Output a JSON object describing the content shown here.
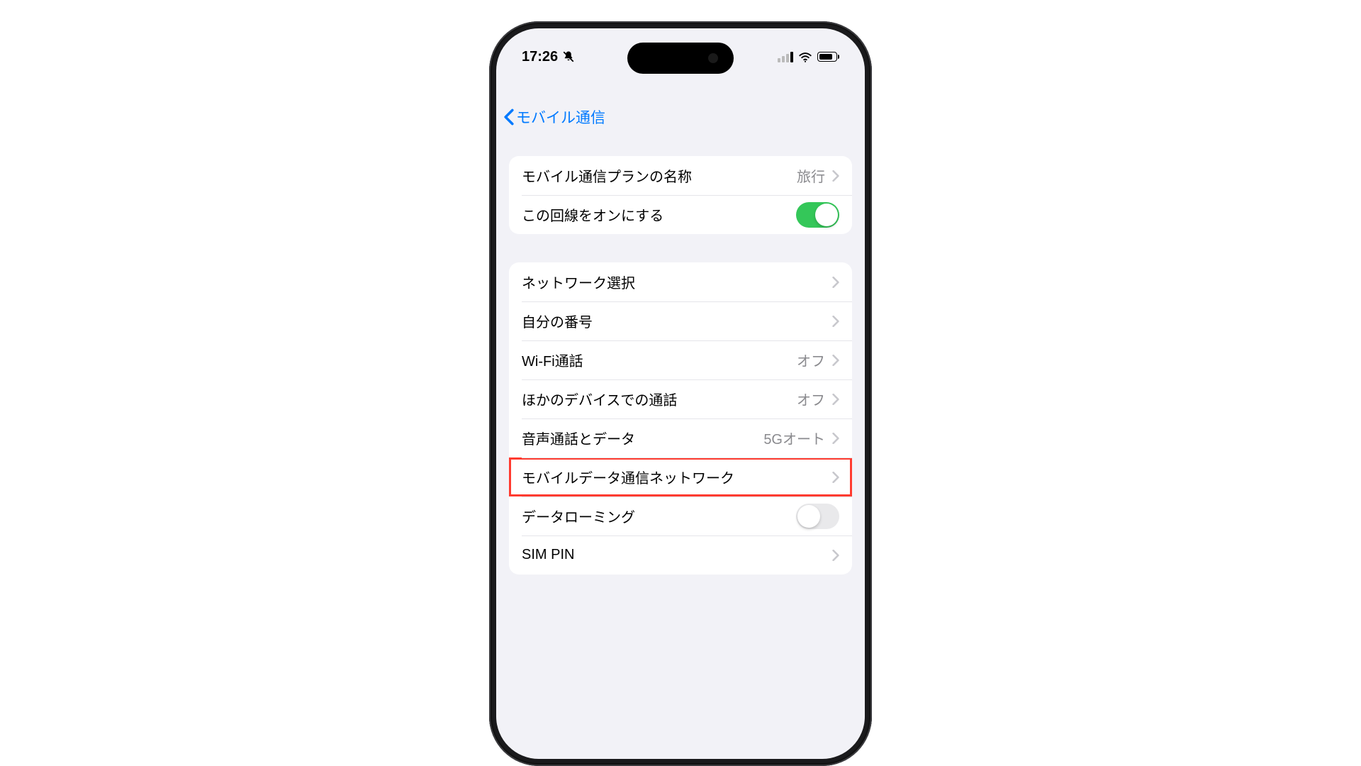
{
  "status_bar": {
    "time": "17:26"
  },
  "nav": {
    "back_label": "モバイル通信"
  },
  "sections": {
    "group1": {
      "plan_name_label": "モバイル通信プランの名称",
      "plan_name_value": "旅行",
      "enable_line_label": "この回線をオンにする"
    },
    "group2": {
      "network_select_label": "ネットワーク選択",
      "my_number_label": "自分の番号",
      "wifi_calling_label": "Wi-Fi通話",
      "wifi_calling_value": "オフ",
      "other_devices_label": "ほかのデバイスでの通話",
      "other_devices_value": "オフ",
      "voice_data_label": "音声通話とデータ",
      "voice_data_value": "5Gオート",
      "mobile_network_label": "モバイルデータ通信ネットワーク",
      "data_roaming_label": "データローミング",
      "sim_pin_label": "SIM PIN"
    }
  }
}
